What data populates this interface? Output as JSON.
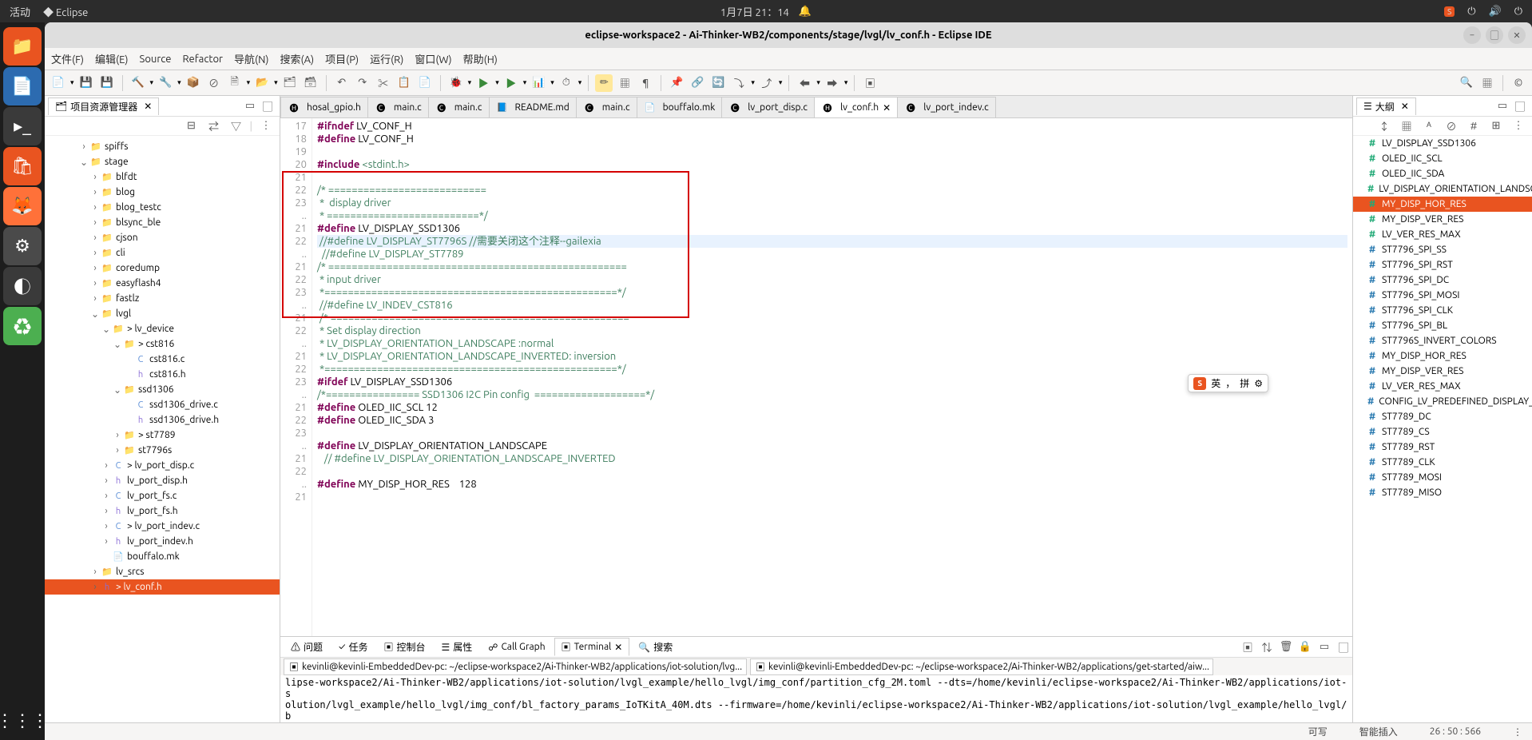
{
  "topbar": {
    "activities": "活动",
    "app": "Eclipse",
    "datetime": "1月7日 21：14"
  },
  "window_title": "eclipse-workspace2 - Ai-Thinker-WB2/components/stage/lvgl/lv_conf.h - Eclipse IDE",
  "menu": {
    "file": "文件(F)",
    "edit": "编辑(E)",
    "source": "Source",
    "refactor": "Refactor",
    "navigate": "导航(N)",
    "search": "搜索(A)",
    "project": "项目(P)",
    "run": "运行(R)",
    "window": "窗口(W)",
    "help": "帮助(H)"
  },
  "project_explorer": {
    "title": "项目资源管理器",
    "tree": [
      {
        "d": 3,
        "exp": ">",
        "icon": "fold",
        "name": "spiffs"
      },
      {
        "d": 3,
        "exp": "v",
        "icon": "fold",
        "name": "stage",
        "dirty": true
      },
      {
        "d": 4,
        "exp": ">",
        "icon": "fold",
        "name": "blfdt"
      },
      {
        "d": 4,
        "exp": ">",
        "icon": "fold",
        "name": "blog"
      },
      {
        "d": 4,
        "exp": ">",
        "icon": "fold",
        "name": "blog_testc"
      },
      {
        "d": 4,
        "exp": ">",
        "icon": "fold",
        "name": "blsync_ble"
      },
      {
        "d": 4,
        "exp": ">",
        "icon": "fold",
        "name": "cjson"
      },
      {
        "d": 4,
        "exp": ">",
        "icon": "fold",
        "name": "cli"
      },
      {
        "d": 4,
        "exp": ">",
        "icon": "fold",
        "name": "coredump"
      },
      {
        "d": 4,
        "exp": ">",
        "icon": "fold",
        "name": "easyflash4"
      },
      {
        "d": 4,
        "exp": ">",
        "icon": "fold",
        "name": "fastlz"
      },
      {
        "d": 4,
        "exp": "v",
        "icon": "fold",
        "name": "lvgl",
        "dirty": true
      },
      {
        "d": 5,
        "exp": "v",
        "icon": "fold",
        "name": "> lv_device",
        "dirty": true
      },
      {
        "d": 6,
        "exp": "v",
        "icon": "fold",
        "name": "> cst816",
        "dirty": true
      },
      {
        "d": 7,
        "exp": "",
        "icon": "cfile",
        "name": "cst816.c"
      },
      {
        "d": 7,
        "exp": "",
        "icon": "hfile",
        "name": "cst816.h"
      },
      {
        "d": 6,
        "exp": "v",
        "icon": "fold",
        "name": "ssd1306",
        "dirty": true
      },
      {
        "d": 7,
        "exp": "",
        "icon": "cfile",
        "name": "ssd1306_drive.c"
      },
      {
        "d": 7,
        "exp": "",
        "icon": "hfile",
        "name": "ssd1306_drive.h"
      },
      {
        "d": 6,
        "exp": ">",
        "icon": "fold",
        "name": "> st7789"
      },
      {
        "d": 6,
        "exp": ">",
        "icon": "fold",
        "name": "st7796s"
      },
      {
        "d": 5,
        "exp": ">",
        "icon": "cfile",
        "name": "> lv_port_disp.c"
      },
      {
        "d": 5,
        "exp": ">",
        "icon": "hfile",
        "name": "lv_port_disp.h"
      },
      {
        "d": 5,
        "exp": ">",
        "icon": "cfile",
        "name": "lv_port_fs.c"
      },
      {
        "d": 5,
        "exp": ">",
        "icon": "hfile",
        "name": "lv_port_fs.h"
      },
      {
        "d": 5,
        "exp": ">",
        "icon": "cfile",
        "name": "> lv_port_indev.c"
      },
      {
        "d": 5,
        "exp": ">",
        "icon": "hfile",
        "name": "lv_port_indev.h"
      },
      {
        "d": 5,
        "exp": "",
        "icon": "mkfile",
        "name": "bouffalo.mk"
      },
      {
        "d": 4,
        "exp": ">",
        "icon": "fold",
        "name": "lv_srcs"
      },
      {
        "d": 4,
        "exp": ">",
        "icon": "hfile",
        "name": "> lv_conf.h",
        "selected": true
      }
    ]
  },
  "editor": {
    "tabs": [
      {
        "icon": "h",
        "label": "hosal_gpio.h"
      },
      {
        "icon": "c",
        "label": "main.c"
      },
      {
        "icon": "c",
        "label": "main.c"
      },
      {
        "icon": "md",
        "label": "README.md"
      },
      {
        "icon": "c",
        "label": "main.c"
      },
      {
        "icon": "mk",
        "label": "bouffalo.mk"
      },
      {
        "icon": "c",
        "label": "lv_port_disp.c"
      },
      {
        "icon": "h",
        "label": "lv_conf.h",
        "active": true
      },
      {
        "icon": "c",
        "label": "lv_port_indev.c"
      }
    ],
    "lines": [
      {
        "n": "17",
        "t": "#ifndef LV_CONF_H",
        "cls": "kw"
      },
      {
        "n": "18",
        "t": "#define LV_CONF_H",
        "cls": "kw"
      },
      {
        "n": "19",
        "t": ""
      },
      {
        "n": "20",
        "t": "#include <stdint.h>",
        "cls": "inc"
      },
      {
        "n": "21",
        "t": ""
      },
      {
        "n": "22",
        "t": "/* ===========================",
        "cls": "cm"
      },
      {
        "n": "23",
        "t": " *  display driver",
        "cls": "cm"
      },
      {
        "n": "..",
        "t": " * ==========================*/",
        "cls": "cm"
      },
      {
        "n": "21",
        "t": "#define LV_DISPLAY_SSD1306",
        "cls": "kw"
      },
      {
        "n": "22",
        "t": " //#define LV_DISPLAY_ST7796S //需要关闭这个注释--gailexia",
        "cls": "cm",
        "hl": true
      },
      {
        "n": "..",
        "t": "  //#define LV_DISPLAY_ST7789",
        "cls": "cm"
      },
      {
        "n": "21",
        "t": "/* ===================================================",
        "cls": "cm"
      },
      {
        "n": "22",
        "t": " * input driver",
        "cls": "cm"
      },
      {
        "n": "23",
        "t": " *==================================================*/",
        "cls": "cm"
      },
      {
        "n": "..",
        "t": " //#define LV_INDEV_CST816",
        "cls": "cm"
      },
      {
        "n": "21",
        "t": " /* ===================================================",
        "cls": "cm"
      },
      {
        "n": "22",
        "t": " * Set display direction",
        "cls": "cm"
      },
      {
        "n": "..",
        "t": " * LV_DISPLAY_ORIENTATION_LANDSCAPE :normal",
        "cls": "cm"
      },
      {
        "n": "21",
        "t": " * LV_DISPLAY_ORIENTATION_LANDSCAPE_INVERTED: inversion",
        "cls": "cm"
      },
      {
        "n": "22",
        "t": " *==================================================*/",
        "cls": "cm"
      },
      {
        "n": "23",
        "t": "#ifdef LV_DISPLAY_SSD1306",
        "cls": "kw"
      },
      {
        "n": "..",
        "t": "/*================ SSD1306 I2C Pin config  ===================*/",
        "cls": "cm"
      },
      {
        "n": "21",
        "t": "#define OLED_IIC_SCL 12",
        "cls": "kw"
      },
      {
        "n": "22",
        "t": "#define OLED_IIC_SDA 3",
        "cls": "kw"
      },
      {
        "n": "23",
        "t": ""
      },
      {
        "n": "..",
        "t": "#define LV_DISPLAY_ORIENTATION_LANDSCAPE",
        "cls": "kw"
      },
      {
        "n": "21",
        "t": "   // #define LV_DISPLAY_ORIENTATION_LANDSCAPE_INVERTED",
        "cls": "cm"
      },
      {
        "n": "22",
        "t": ""
      },
      {
        "n": "..",
        "t": "#define MY_DISP_HOR_RES    128",
        "cls": "kw"
      },
      {
        "n": "21",
        "t": ""
      }
    ]
  },
  "outline": {
    "title": "大纲",
    "items": [
      {
        "k": "#",
        "t": "LV_DISPLAY_SSD1306"
      },
      {
        "k": "#",
        "t": "OLED_IIC_SCL"
      },
      {
        "k": "#",
        "t": "OLED_IIC_SDA"
      },
      {
        "k": "#",
        "t": "LV_DISPLAY_ORIENTATION_LANDSCA"
      },
      {
        "k": "#",
        "t": "MY_DISP_HOR_RES",
        "sel": true
      },
      {
        "k": "#",
        "t": "MY_DISP_VER_RES"
      },
      {
        "k": "#",
        "t": "LV_VER_RES_MAX"
      },
      {
        "k": "d",
        "t": "ST7796_SPI_SS"
      },
      {
        "k": "d",
        "t": "ST7796_SPI_RST"
      },
      {
        "k": "d",
        "t": "ST7796_SPI_DC"
      },
      {
        "k": "d",
        "t": "ST7796_SPI_MOSI"
      },
      {
        "k": "d",
        "t": "ST7796_SPI_CLK"
      },
      {
        "k": "d",
        "t": "ST7796_SPI_BL"
      },
      {
        "k": "d",
        "t": "ST7796S_INVERT_COLORS"
      },
      {
        "k": "d",
        "t": "MY_DISP_HOR_RES"
      },
      {
        "k": "d",
        "t": "MY_DISP_VER_RES"
      },
      {
        "k": "d",
        "t": "LV_VER_RES_MAX"
      },
      {
        "k": "d",
        "t": "CONFIG_LV_PREDEFINED_DISPLAY_N"
      },
      {
        "k": "d",
        "t": "ST7789_DC"
      },
      {
        "k": "d",
        "t": "ST7789_CS"
      },
      {
        "k": "d",
        "t": "ST7789_RST"
      },
      {
        "k": "d",
        "t": "ST7789_CLK"
      },
      {
        "k": "d",
        "t": "ST7789_MOSI"
      },
      {
        "k": "d",
        "t": "ST7789_MISO"
      }
    ]
  },
  "bottom": {
    "tabs": {
      "problems": "问题",
      "tasks": "任务",
      "console": "控制台",
      "properties": "属性",
      "callgraph": "Call Graph",
      "terminal": "Terminal",
      "search": "搜索"
    },
    "term1": "kevinli@kevinli-EmbeddedDev-pc: ~/eclipse-workspace2/Ai-Thinker-WB2/applications/iot-solution/lvg...",
    "term2": "kevinli@kevinli-EmbeddedDev-pc: ~/eclipse-workspace2/Ai-Thinker-WB2/applications/get-started/aiw...",
    "body": "lipse-workspace2/Ai-Thinker-WB2/applications/iot-solution/lvgl_example/hello_lvgl/img_conf/partition_cfg_2M.toml --dts=/home/kevinli/eclipse-workspace2/Ai-Thinker-WB2/applications/iot-s\nolution/lvgl_example/hello_lvgl/img_conf/bl_factory_params_IoTKitA_40M.dts --firmware=/home/kevinli/eclipse-workspace2/Ai-Thinker-WB2/applications/iot-solution/lvgl_example/hello_lvgl/b\nuild_out/hello_lvgl.bin\nkevinli@kevinli-EmbeddedDev-pc:~/eclipse-workspace2/Ai-Thinker-WB2/applications/iot-solution/lvgl_example/hello_lvgl$"
  },
  "status": {
    "writable": "可写",
    "insert": "智能插入",
    "pos": "26 : 50 : 566"
  },
  "ime": {
    "lang": "英",
    "mode": "拼"
  }
}
